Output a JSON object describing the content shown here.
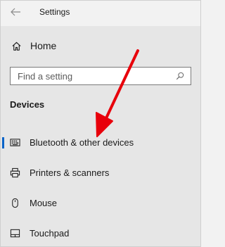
{
  "window": {
    "title": "Settings",
    "back_icon": "back-arrow-icon"
  },
  "sidebar": {
    "home": {
      "label": "Home",
      "icon": "home-icon"
    },
    "search": {
      "placeholder": "Find a setting",
      "value": "",
      "icon": "search-icon"
    },
    "section_heading": "Devices",
    "items": [
      {
        "label": "Bluetooth & other devices",
        "icon": "bluetooth-devices-icon",
        "selected": true
      },
      {
        "label": "Printers & scanners",
        "icon": "printer-icon",
        "selected": false
      },
      {
        "label": "Mouse",
        "icon": "mouse-icon",
        "selected": false
      },
      {
        "label": "Touchpad",
        "icon": "touchpad-icon",
        "selected": false
      }
    ]
  },
  "colors": {
    "accent": "#0a64c8",
    "annotation_arrow": "#e8000b",
    "sidebar_background": "#e6e6e6",
    "titlebar_background": "#f2f2f2"
  }
}
